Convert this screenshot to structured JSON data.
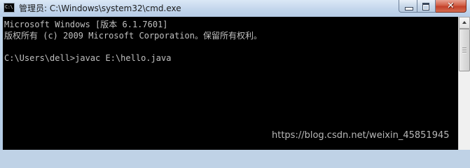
{
  "window": {
    "title": "管理员: C:\\Windows\\system32\\cmd.exe",
    "app_icon_glyph": "C:\\"
  },
  "controls": {
    "minimize": "minimize",
    "maximize": "maximize",
    "close_glyph": "✕"
  },
  "console": {
    "lines": [
      "Microsoft Windows [版本 6.1.7601]",
      "版权所有 (c) 2009 Microsoft Corporation。保留所有权利。",
      "",
      "C:\\Users\\dell>javac E:\\hello.java"
    ],
    "text_color": "#c0c0c0",
    "background_color": "#000000"
  },
  "watermark": "https://blog.csdn.net/weixin_45851945"
}
